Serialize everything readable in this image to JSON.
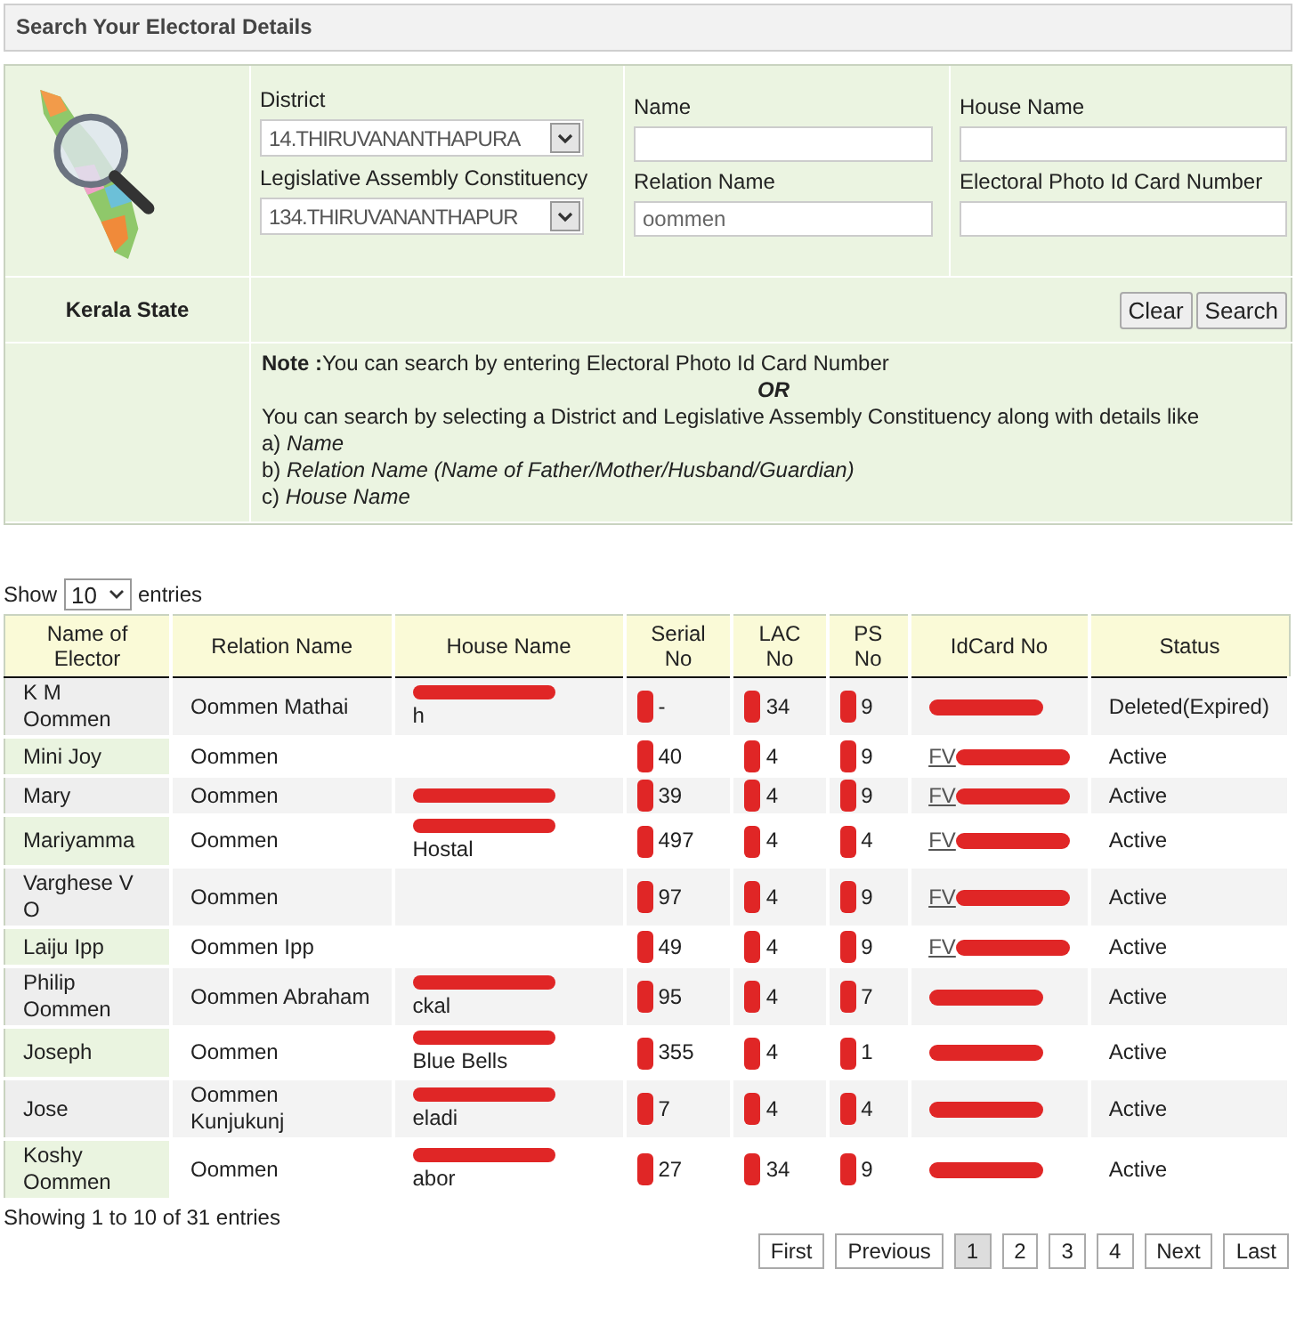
{
  "panel_title": "Search Your Electoral Details",
  "form": {
    "state_label": "Kerala State",
    "district": {
      "label": "District",
      "value": "14.THIRUVANANTHAPURA"
    },
    "constituency": {
      "label": "Legislative Assembly Constituency",
      "value": "134.THIRUVANANTHAPUR"
    },
    "name": {
      "label": "Name"
    },
    "house_name": {
      "label": "House Name"
    },
    "relation_name": {
      "label": "Relation Name",
      "value": "oommen"
    },
    "epic": {
      "label": "Electoral Photo Id Card Number"
    },
    "buttons": [
      "Clear",
      "Search"
    ],
    "note": {
      "title": "Note :",
      "line1": "You can search by entering Electoral Photo Id Card Number",
      "or": "OR",
      "line2": "You can search by selecting a District and Legislative Assembly Constituency along with details like",
      "items": [
        {
          "prefix": "a)",
          "text": "Name"
        },
        {
          "prefix": "b)",
          "text": "Relation Name (Name of Father/Mother/Husband/Guardian)"
        },
        {
          "prefix": "c)",
          "text": "House Name"
        }
      ]
    }
  },
  "length": {
    "show": "Show",
    "value": "10",
    "entries": "entries"
  },
  "table": {
    "columns": [
      "Name of Elector",
      "Relation Name",
      "House Name",
      "Serial No",
      "LAC No",
      "PS No",
      "IdCard No",
      "Status"
    ],
    "redacted": {
      "serial": true,
      "lac": true,
      "ps": true,
      "idcard": true
    },
    "rows": [
      {
        "name": "K M Oommen",
        "relation": "Oommen Mathai",
        "house": "h",
        "house_redacted": true,
        "serial": "-",
        "lac": "34",
        "ps": "9",
        "status": "Deleted(Expired)"
      },
      {
        "name": "Mini Joy",
        "relation": "Oommen",
        "house_redacted": false,
        "serial": "40",
        "lac": "4",
        "ps": "9",
        "idcard": "FV",
        "status": "Active"
      },
      {
        "name": "Mary",
        "relation": "Oommen",
        "house_redacted": true,
        "serial": "39",
        "lac": "4",
        "ps": "9",
        "idcard": "FV",
        "status": "Active"
      },
      {
        "name": "Mariyamma",
        "relation": "Oommen",
        "house": "Hostal",
        "house_redacted": true,
        "serial": "497",
        "lac": "4",
        "ps": "4",
        "idcard": "FV",
        "status": "Active"
      },
      {
        "name": "Varghese V O",
        "relation": "Oommen",
        "house_redacted": false,
        "serial": "97",
        "lac": "4",
        "ps": "9",
        "idcard": "FV",
        "status": "Active"
      },
      {
        "name": "Laiju Ipp",
        "relation": "Oommen Ipp",
        "house_redacted": false,
        "serial": "49",
        "lac": "4",
        "ps": "9",
        "idcard": "FV",
        "status": "Active"
      },
      {
        "name": "Philip Oommen",
        "relation": "Oommen Abraham",
        "house": "ckal",
        "house_redacted": true,
        "serial": "95",
        "lac": "4",
        "ps": "7",
        "status": "Active"
      },
      {
        "name": "Joseph",
        "relation": "Oommen",
        "house": "Blue Bells",
        "house_redacted": true,
        "serial": "355",
        "lac": "4",
        "ps": "1",
        "status": "Active"
      },
      {
        "name": "Jose",
        "relation": "Oommen Kunjukunj",
        "house": "eladi",
        "house_redacted": true,
        "serial": "7",
        "lac": "4",
        "ps": "4",
        "status": "Active"
      },
      {
        "name": "Koshy Oommen",
        "relation": "Oommen",
        "house": "abor",
        "house_redacted": true,
        "serial": "27",
        "lac": "34",
        "ps": "9",
        "status": "Active"
      }
    ]
  },
  "info": "Showing 1 to 10 of 31 entries",
  "pagination": [
    {
      "label": "First",
      "selected": false
    },
    {
      "label": "Previous",
      "selected": false
    },
    {
      "label": "1",
      "selected": true
    },
    {
      "label": "2",
      "selected": false
    },
    {
      "label": "3",
      "selected": false
    },
    {
      "label": "4",
      "selected": false
    },
    {
      "label": "Next",
      "selected": false
    },
    {
      "label": "Last",
      "selected": false
    }
  ]
}
